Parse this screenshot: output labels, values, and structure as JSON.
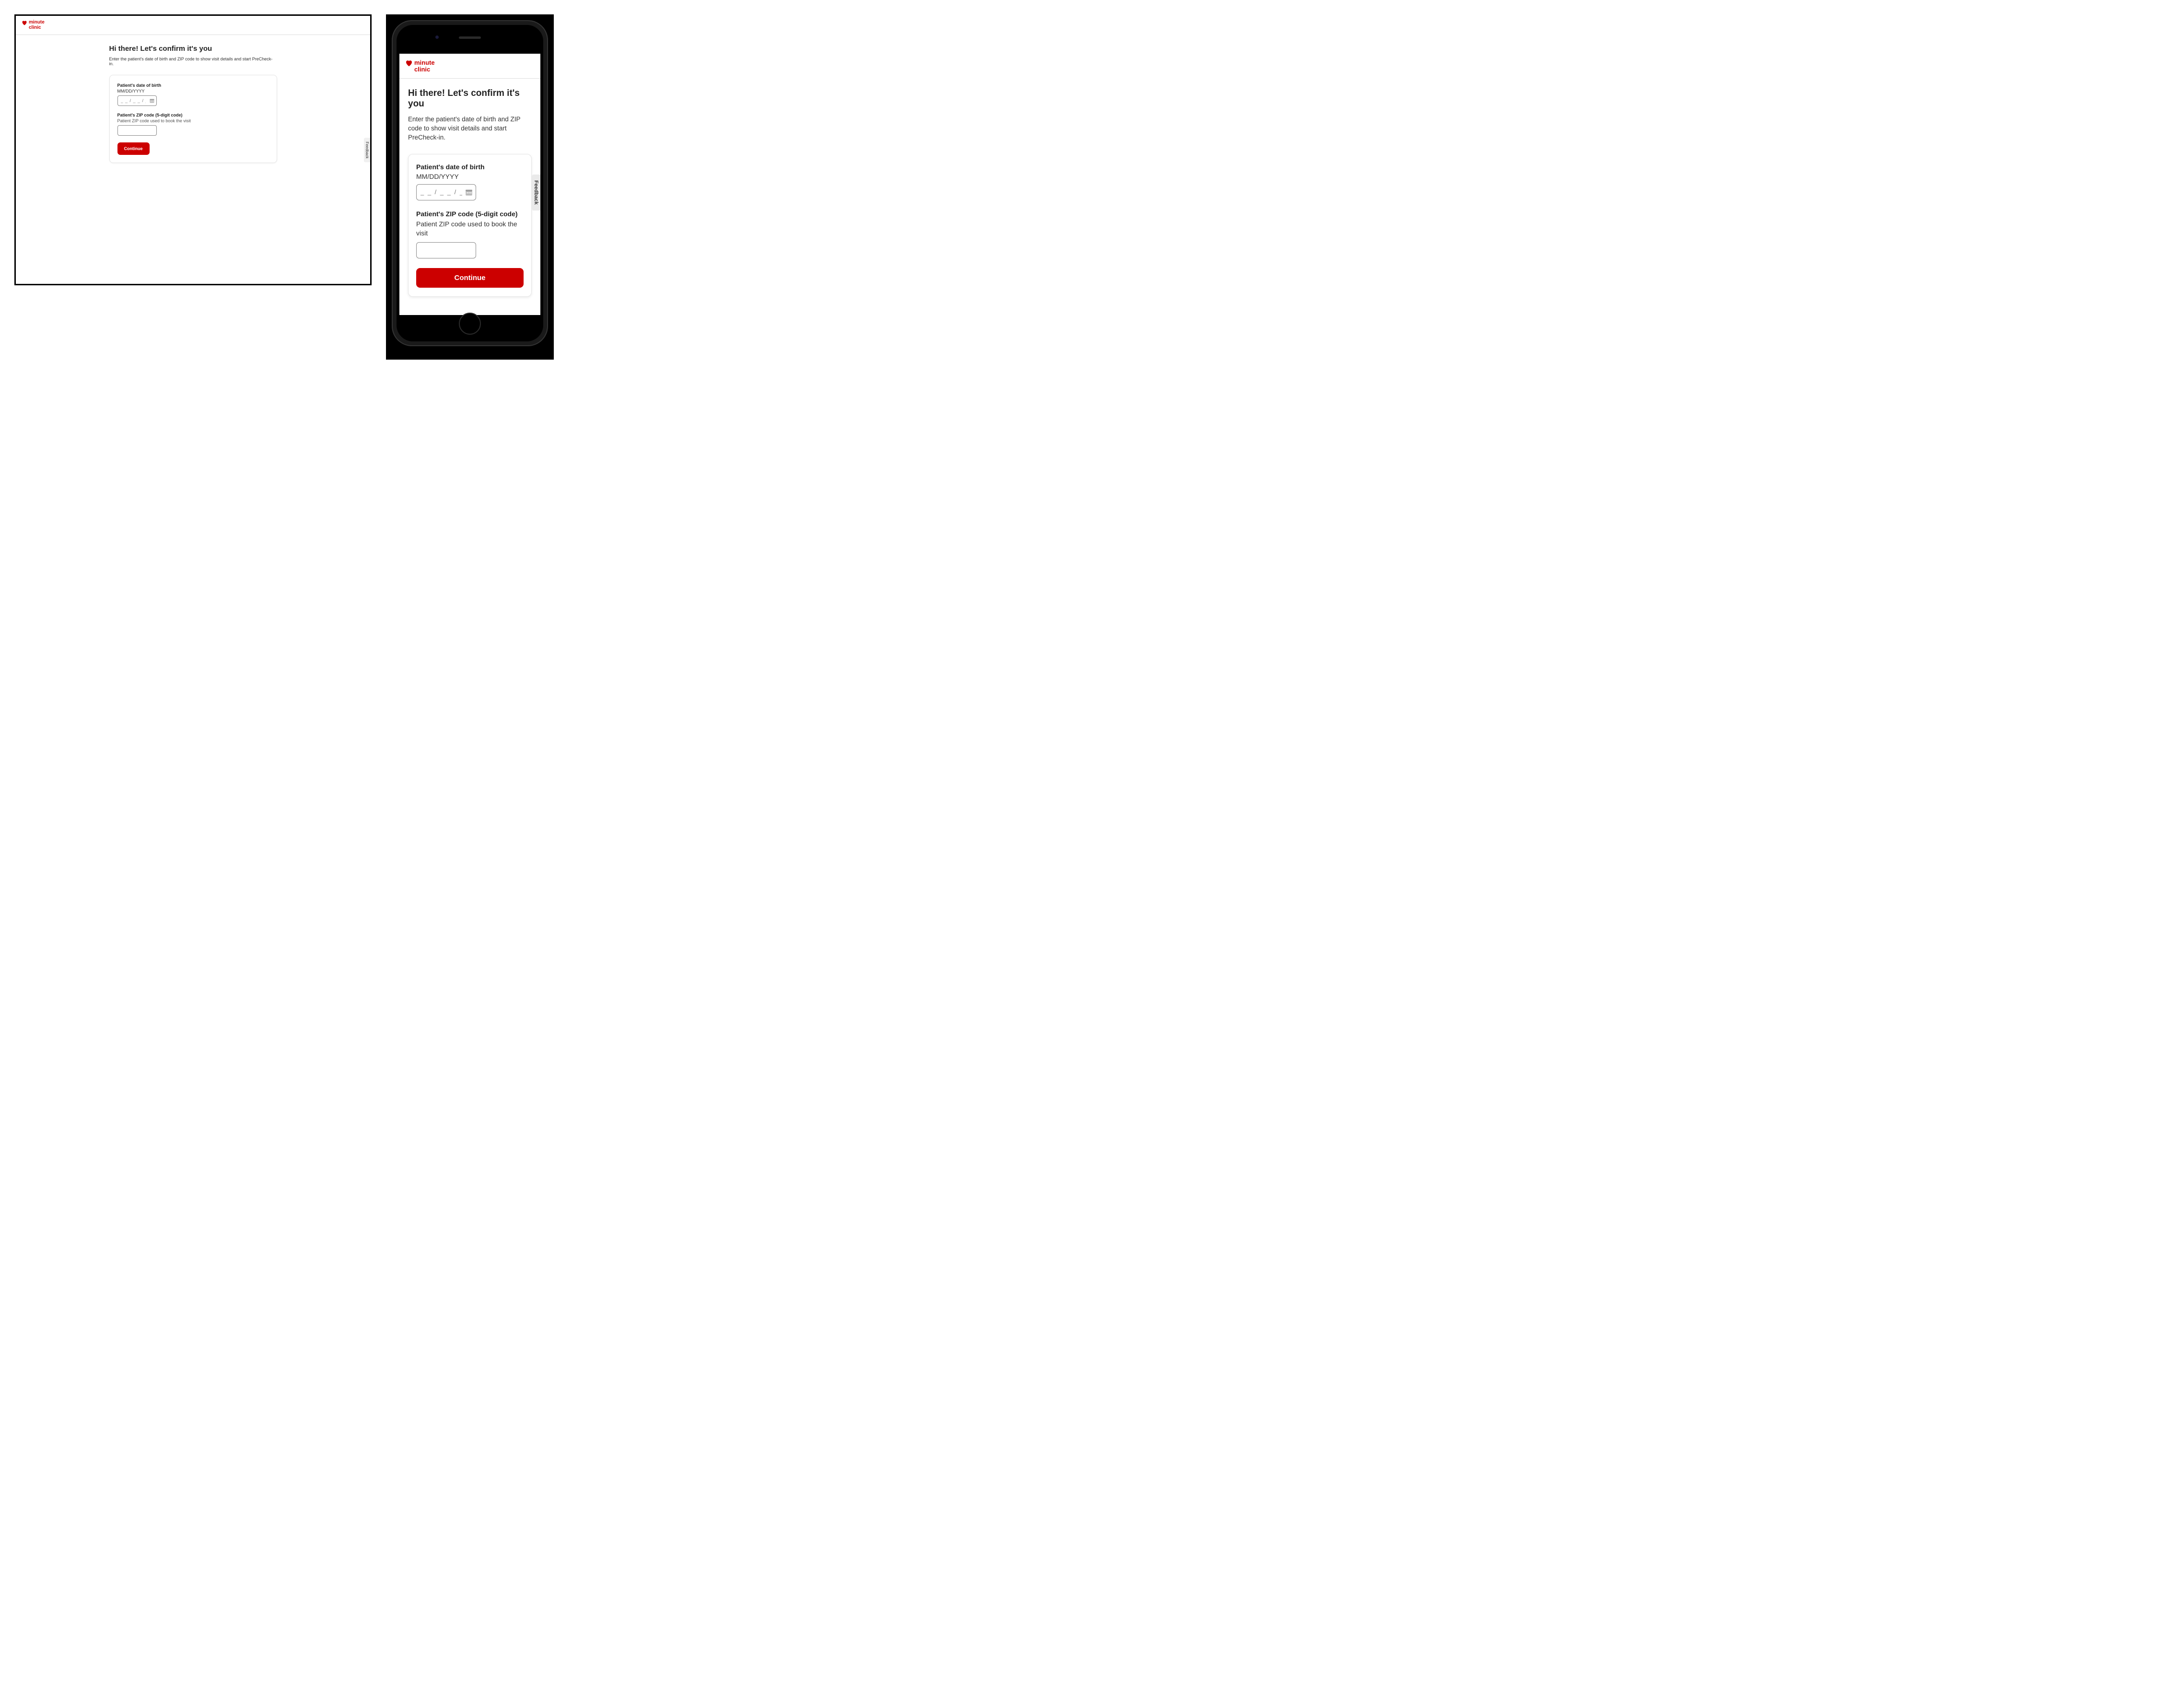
{
  "brand": {
    "line1": "minute",
    "line2": "clinic",
    "color": "#cc0000"
  },
  "page": {
    "heading": "Hi there! Let's confirm it's you",
    "subheading_desktop": "Enter the patient's date of birth and ZIP code to show visit details and start PreCheck-in.",
    "subheading_mobile": "Enter the patient's date of birth and ZIP code to show visit details and start PreCheck-in."
  },
  "form": {
    "dob": {
      "label": "Patient's date of birth",
      "format": "MM/DD/YYYY",
      "placeholder": "_ _ / _ _ / _ _ _ _",
      "value": ""
    },
    "zip": {
      "label": "Patient's ZIP code (5-digit code)",
      "help": "Patient ZIP code used to book the visit",
      "value": ""
    },
    "submit_label": "Continue"
  },
  "feedback_label": "Feedback"
}
